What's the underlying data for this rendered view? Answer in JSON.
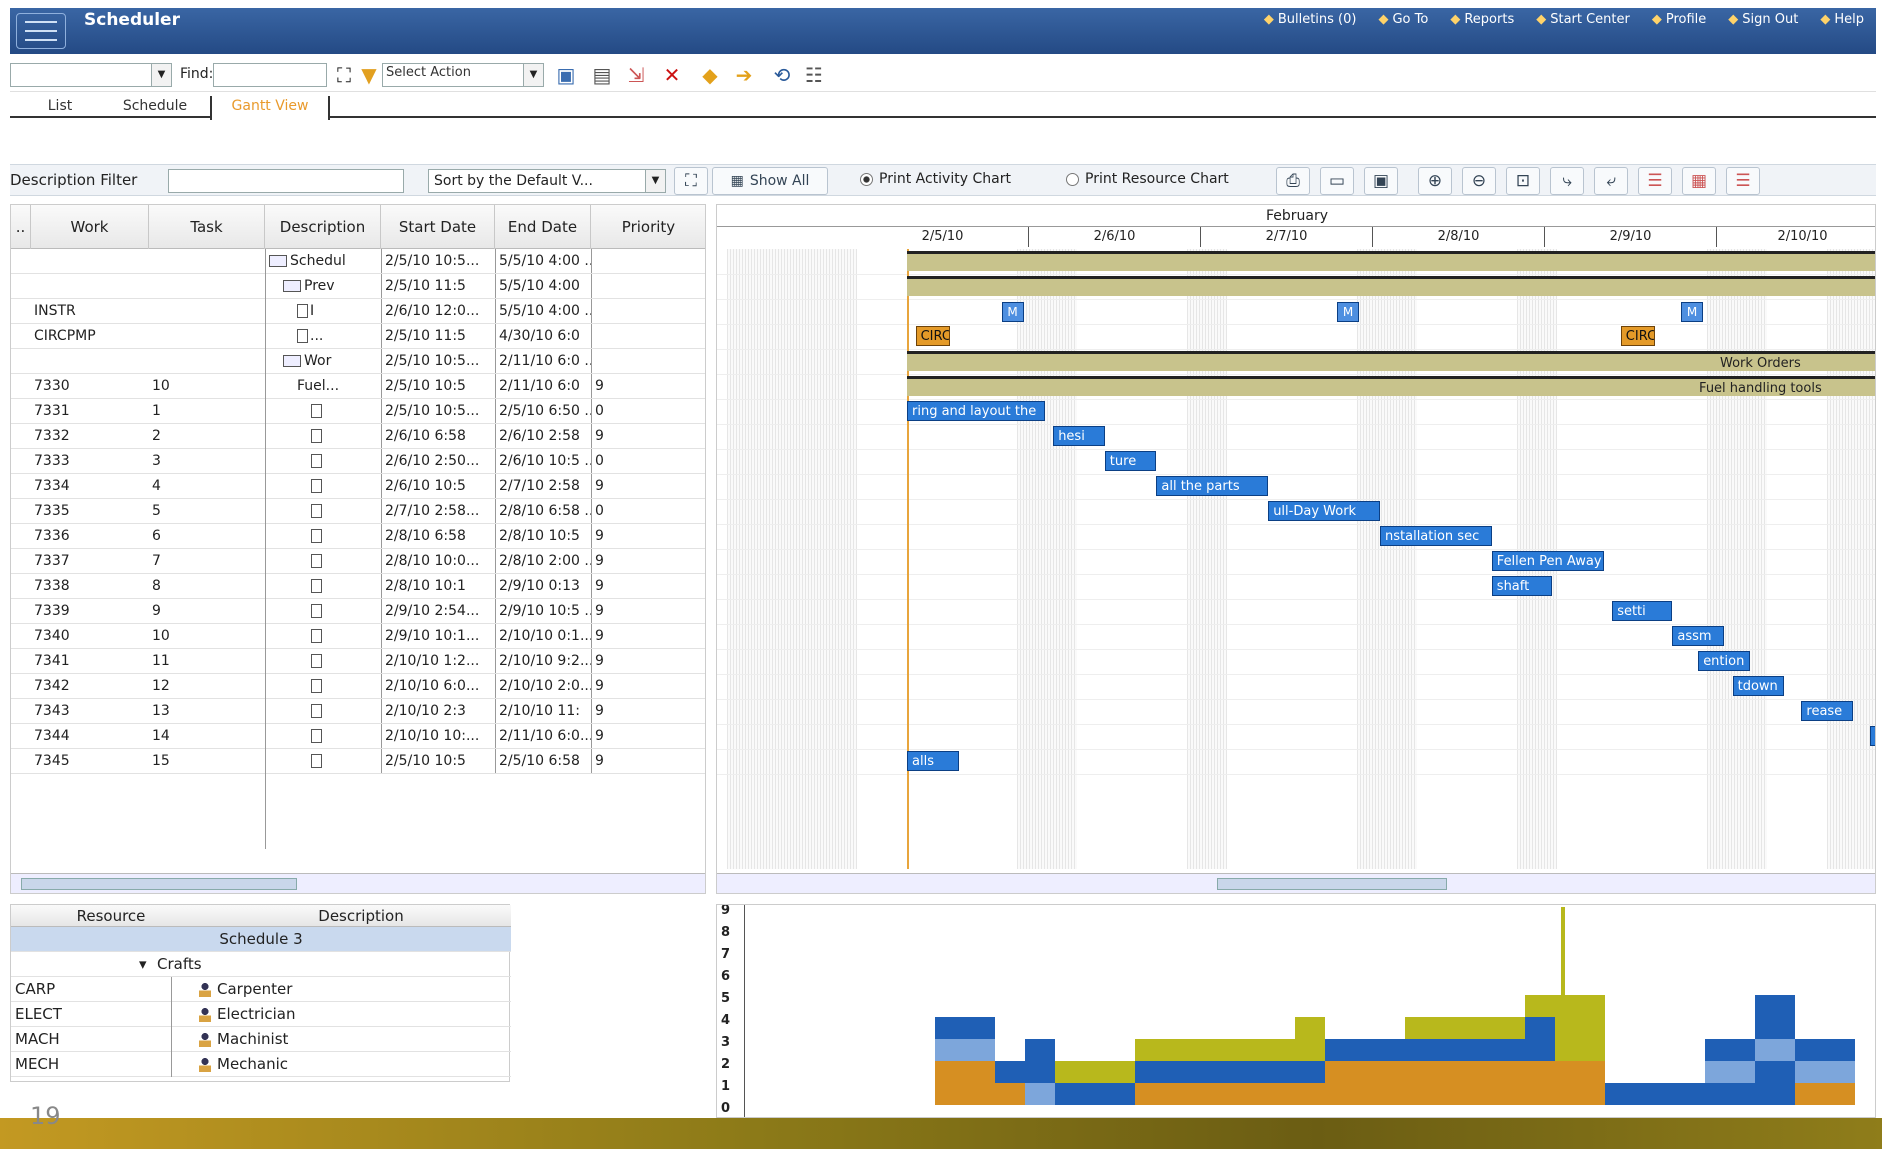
{
  "app": {
    "title": "Scheduler"
  },
  "topnav": [
    {
      "label": "Bulletins (0)",
      "icon": "bulletin-icon"
    },
    {
      "label": "Go To",
      "icon": "goto-icon"
    },
    {
      "label": "Reports",
      "icon": "reports-icon"
    },
    {
      "label": "Start Center",
      "icon": "start-center-icon"
    },
    {
      "label": "Profile",
      "icon": "profile-icon"
    },
    {
      "label": "Sign Out",
      "icon": "sign-out-icon"
    },
    {
      "label": "Help",
      "icon": "help-icon"
    }
  ],
  "toolbar": {
    "find_label": "Find:",
    "select_action": "Select Action",
    "find_value": "",
    "search_value": ""
  },
  "tabs": [
    {
      "label": "List"
    },
    {
      "label": "Schedule"
    },
    {
      "label": "Gantt View",
      "active": true
    }
  ],
  "filterbar": {
    "description_filter_label": "Description Filter",
    "sort_value": "Sort by the Default V...",
    "show_all_label": "Show All",
    "print_activity_label": "Print Activity Chart",
    "print_resource_label": "Print Resource Chart"
  },
  "grid": {
    "columns": [
      "Work",
      "Task",
      "Description",
      "Start Date",
      "End Date",
      "Priority"
    ],
    "rows": [
      {
        "work": "",
        "task": "",
        "desc": "Schedul",
        "start": "2/5/10 10:5...",
        "end": "5/5/10 4:00 ...",
        "prio": "",
        "icon": "folder",
        "indent": 0
      },
      {
        "work": "",
        "task": "",
        "desc": "Prev",
        "start": "2/5/10 11:5",
        "end": "5/5/10 4:00",
        "prio": "",
        "icon": "folder",
        "indent": 1
      },
      {
        "work": "INSTR",
        "task": "",
        "desc": "I",
        "start": "2/6/10 12:0...",
        "end": "5/5/10 4:00 ...",
        "prio": "",
        "icon": "doc",
        "indent": 2
      },
      {
        "work": "CIRCPMP",
        "task": "",
        "desc": "...",
        "start": "2/5/10 11:5",
        "end": "4/30/10 6:0",
        "prio": "",
        "icon": "doc",
        "indent": 2
      },
      {
        "work": "",
        "task": "",
        "desc": "Wor",
        "start": "2/5/10 10:5...",
        "end": "2/11/10 6:0 ...",
        "prio": "",
        "icon": "folder",
        "indent": 1
      },
      {
        "work": "7330",
        "task": "10",
        "desc": "Fuel...",
        "start": "2/5/10 10:5",
        "end": "2/11/10 6:0",
        "prio": "9",
        "icon": "none",
        "indent": 2
      },
      {
        "work": "7331",
        "task": "1",
        "desc": "",
        "start": "2/5/10 10:5...",
        "end": "2/5/10 6:50 ...",
        "prio": "0",
        "icon": "doc",
        "indent": 3
      },
      {
        "work": "7332",
        "task": "2",
        "desc": "",
        "start": "2/6/10 6:58",
        "end": "2/6/10 2:58",
        "prio": "9",
        "icon": "doc",
        "indent": 3
      },
      {
        "work": "7333",
        "task": "3",
        "desc": "",
        "start": "2/6/10 2:50...",
        "end": "2/6/10 10:5 ...",
        "prio": "0",
        "icon": "doc",
        "indent": 3
      },
      {
        "work": "7334",
        "task": "4",
        "desc": "",
        "start": "2/6/10 10:5",
        "end": "2/7/10 2:58",
        "prio": "9",
        "icon": "doc",
        "indent": 3
      },
      {
        "work": "7335",
        "task": "5",
        "desc": "",
        "start": "2/7/10 2:58...",
        "end": "2/8/10 6:58 ...",
        "prio": "0",
        "icon": "doc",
        "indent": 3
      },
      {
        "work": "7336",
        "task": "6",
        "desc": "",
        "start": "2/8/10 6:58",
        "end": "2/8/10 10:5",
        "prio": "9",
        "icon": "doc",
        "indent": 3
      },
      {
        "work": "7337",
        "task": "7",
        "desc": "",
        "start": "2/8/10 10:0...",
        "end": "2/8/10 2:00 ...",
        "prio": "9",
        "icon": "doc",
        "indent": 3
      },
      {
        "work": "7338",
        "task": "8",
        "desc": "",
        "start": "2/8/10 10:1",
        "end": "2/9/10 0:13",
        "prio": "9",
        "icon": "doc",
        "indent": 3
      },
      {
        "work": "7339",
        "task": "9",
        "desc": "",
        "start": "2/9/10 2:54...",
        "end": "2/9/10 10:5 ...",
        "prio": "9",
        "icon": "doc",
        "indent": 3
      },
      {
        "work": "7340",
        "task": "10",
        "desc": "",
        "start": "2/9/10 10:1...",
        "end": "2/10/10 0:1...",
        "prio": "9",
        "icon": "doc",
        "indent": 3
      },
      {
        "work": "7341",
        "task": "11",
        "desc": "",
        "start": "2/10/10 1:2...",
        "end": "2/10/10 9:2...",
        "prio": "9",
        "icon": "doc",
        "indent": 3
      },
      {
        "work": "7342",
        "task": "12",
        "desc": "",
        "start": "2/10/10 6:0...",
        "end": "2/10/10 2:0...",
        "prio": "9",
        "icon": "doc",
        "indent": 3
      },
      {
        "work": "7343",
        "task": "13",
        "desc": "",
        "start": "2/10/10 2:3",
        "end": "2/10/10 11:",
        "prio": "9",
        "icon": "doc",
        "indent": 3
      },
      {
        "work": "7344",
        "task": "14",
        "desc": "",
        "start": "2/10/10 10:...",
        "end": "2/11/10 6:0...",
        "prio": "9",
        "icon": "doc",
        "indent": 3
      },
      {
        "work": "7345",
        "task": "15",
        "desc": "",
        "start": "2/5/10 10:5",
        "end": "2/5/10 6:58",
        "prio": "9",
        "icon": "doc",
        "indent": 3
      }
    ]
  },
  "gantt": {
    "month": "February",
    "days": [
      "2/5/10",
      "2/6/10",
      "2/7/10",
      "2/8/10",
      "2/9/10",
      "2/10/10"
    ],
    "bars": [
      {
        "row": 0,
        "start": 0.0,
        "end": 9.9,
        "type": "sum",
        "label": ""
      },
      {
        "row": 1,
        "start": 0.0,
        "end": 9.9,
        "type": "sum",
        "label": ""
      },
      {
        "row": 4,
        "start": 0.0,
        "end": 9.9,
        "type": "sum",
        "label": "Work Orders"
      },
      {
        "row": 5,
        "start": 0.0,
        "end": 9.9,
        "type": "sum",
        "label": "Fuel handling tools"
      },
      {
        "row": 6,
        "start": 0.0,
        "end": 0.8,
        "type": "blue",
        "label": "ring and layout the"
      },
      {
        "row": 7,
        "start": 0.85,
        "end": 1.15,
        "type": "blue",
        "label": "hesi"
      },
      {
        "row": 8,
        "start": 1.15,
        "end": 1.45,
        "type": "blue",
        "label": "ture"
      },
      {
        "row": 9,
        "start": 1.45,
        "end": 2.1,
        "type": "blue",
        "label": "all the parts"
      },
      {
        "row": 10,
        "start": 2.1,
        "end": 2.75,
        "type": "blue",
        "label": "ull-Day Work"
      },
      {
        "row": 11,
        "start": 2.75,
        "end": 3.4,
        "type": "blue",
        "label": "nstallation sec"
      },
      {
        "row": 12,
        "start": 3.4,
        "end": 4.05,
        "type": "blue",
        "label": "Fellen Pen Away"
      },
      {
        "row": 13,
        "start": 3.4,
        "end": 3.75,
        "type": "blue",
        "label": "shaft"
      },
      {
        "row": 14,
        "start": 4.1,
        "end": 4.45,
        "type": "blue",
        "label": "setti"
      },
      {
        "row": 15,
        "start": 4.45,
        "end": 4.75,
        "type": "blue",
        "label": "assm"
      },
      {
        "row": 16,
        "start": 4.6,
        "end": 4.9,
        "type": "blue",
        "label": "ention"
      },
      {
        "row": 17,
        "start": 4.8,
        "end": 5.1,
        "type": "blue",
        "label": "tdown"
      },
      {
        "row": 18,
        "start": 5.2,
        "end": 5.5,
        "type": "blue",
        "label": "rease"
      },
      {
        "row": 19,
        "start": 5.6,
        "end": 5.9,
        "type": "blue",
        "label": "co"
      },
      {
        "row": 20,
        "start": 0.0,
        "end": 0.3,
        "type": "blue",
        "label": "alls"
      },
      {
        "row": 3,
        "start": 0.05,
        "end": 0.25,
        "type": "orange",
        "label": "CIRC"
      },
      {
        "row": 3,
        "start": 4.15,
        "end": 4.35,
        "type": "orange",
        "label": "CIRC"
      }
    ],
    "milestones": [
      {
        "row": 2,
        "pos": 0.55,
        "label": "M"
      },
      {
        "row": 2,
        "pos": 2.5,
        "label": "M"
      },
      {
        "row": 2,
        "pos": 4.5,
        "label": "M"
      }
    ]
  },
  "resources": {
    "columns": [
      "Resource",
      "Description"
    ],
    "schedule": "Schedule 3",
    "group": "Crafts",
    "rows": [
      {
        "code": "CARP",
        "desc": "Carpenter"
      },
      {
        "code": "ELECT",
        "desc": "Electrician"
      },
      {
        "code": "MACH",
        "desc": "Machinist"
      },
      {
        "code": "MECH",
        "desc": "Mechanic"
      }
    ]
  },
  "histogram": {
    "yticks": [
      "9",
      "8",
      "7",
      "6",
      "5",
      "4",
      "3",
      "2",
      "1",
      "0"
    ],
    "colors": {
      "orange": "#d68f22",
      "blue": "#1f5fb5",
      "lightblue": "#7da6db",
      "yellow": "#b8b81c"
    }
  },
  "slide_number": "19"
}
